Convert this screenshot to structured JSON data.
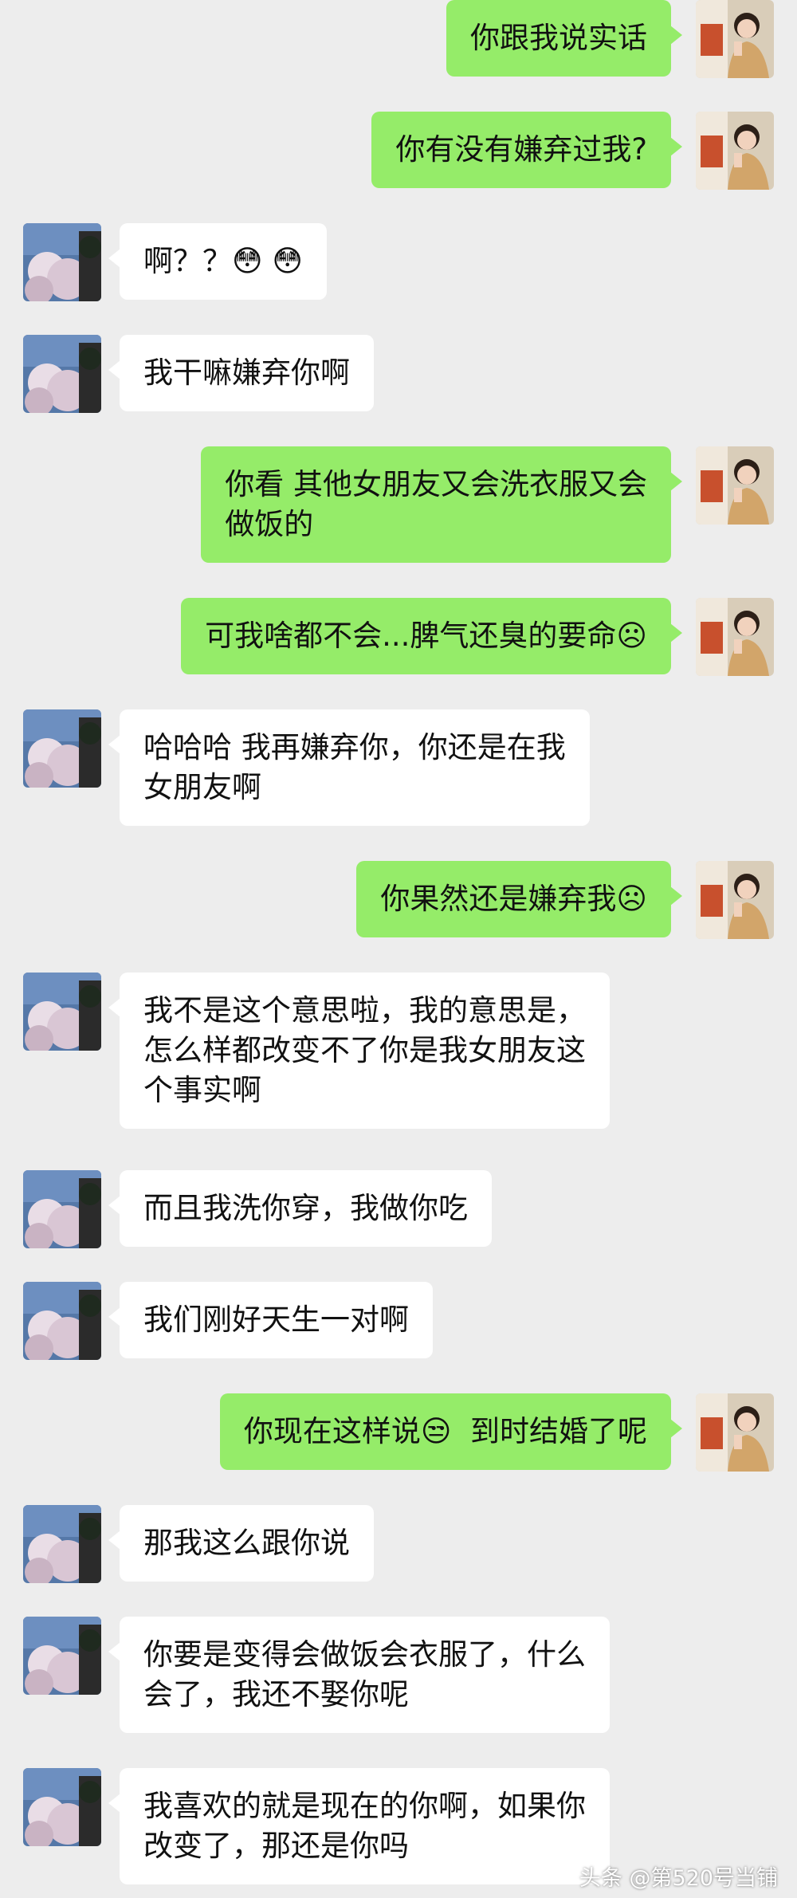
{
  "messages": [
    {
      "side": "out",
      "text": "你跟我说实话"
    },
    {
      "side": "out",
      "text": "你有没有嫌弃过我?"
    },
    {
      "side": "in",
      "text": "啊？？😳 😳"
    },
    {
      "side": "in",
      "text": "我干嘛嫌弃你啊"
    },
    {
      "side": "out",
      "text": "你看 其他女朋友又会洗衣服又会\n做饭的"
    },
    {
      "side": "out",
      "text": "可我啥都不会...脾气还臭的要命☹"
    },
    {
      "side": "in",
      "text": "哈哈哈 我再嫌弃你，你还是在我\n女朋友啊"
    },
    {
      "side": "out",
      "text": "你果然还是嫌弃我☹"
    },
    {
      "side": "in",
      "text": "我不是这个意思啦，我的意思是，\n怎么样都改变不了你是我女朋友这\n个事实啊"
    },
    {
      "side": "in",
      "text": "而且我洗你穿，我做你吃"
    },
    {
      "side": "in",
      "text": "我们刚好天生一对啊"
    },
    {
      "side": "out",
      "text": "你现在这样说😒  到时结婚了呢"
    },
    {
      "side": "in",
      "text": "那我这么跟你说"
    },
    {
      "side": "in",
      "text": "你要是变得会做饭会衣服了，什么\n会了，我还不娶你呢"
    },
    {
      "side": "in",
      "text": "我喜欢的就是现在的你啊，如果你\n改变了，那还是你吗"
    }
  ],
  "watermark": "头条 @第520号当铺",
  "colors": {
    "outgoing_bubble": "#95ec69",
    "incoming_bubble": "#ffffff",
    "background": "#ededed"
  }
}
